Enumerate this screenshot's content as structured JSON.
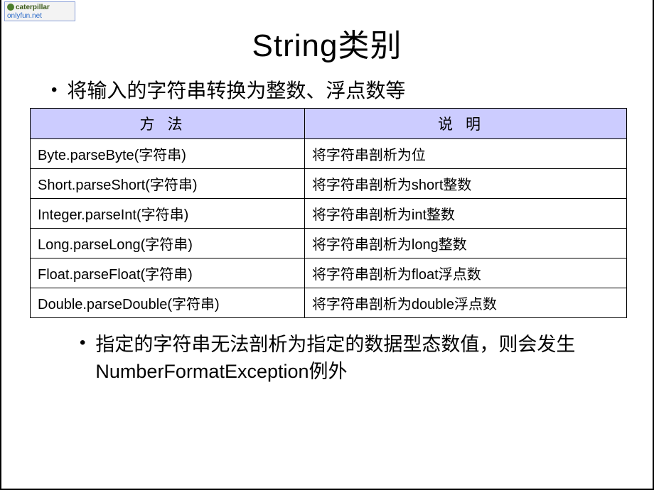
{
  "watermark": {
    "line1": "caterpillar",
    "line2": "onlyfun.net"
  },
  "title": "String类别",
  "bullets": {
    "first": "将输入的字符串转换为整数、浮点数等",
    "second": "指定的字符串无法剖析为指定的数据型态数值，则会发生NumberFormatException例外"
  },
  "table": {
    "headers": {
      "method": "方法",
      "description": "说明"
    },
    "rows": [
      {
        "method": "Byte.parseByte(字符串)",
        "description": "将字符串剖析为位"
      },
      {
        "method": "Short.parseShort(字符串)",
        "description": "将字符串剖析为short整数"
      },
      {
        "method": "Integer.parseInt(字符串)",
        "description": "将字符串剖析为int整数"
      },
      {
        "method": "Long.parseLong(字符串)",
        "description": "将字符串剖析为long整数"
      },
      {
        "method": "Float.parseFloat(字符串)",
        "description": "将字符串剖析为float浮点数"
      },
      {
        "method": "Double.parseDouble(字符串)",
        "description": "将字符串剖析为double浮点数"
      }
    ]
  }
}
